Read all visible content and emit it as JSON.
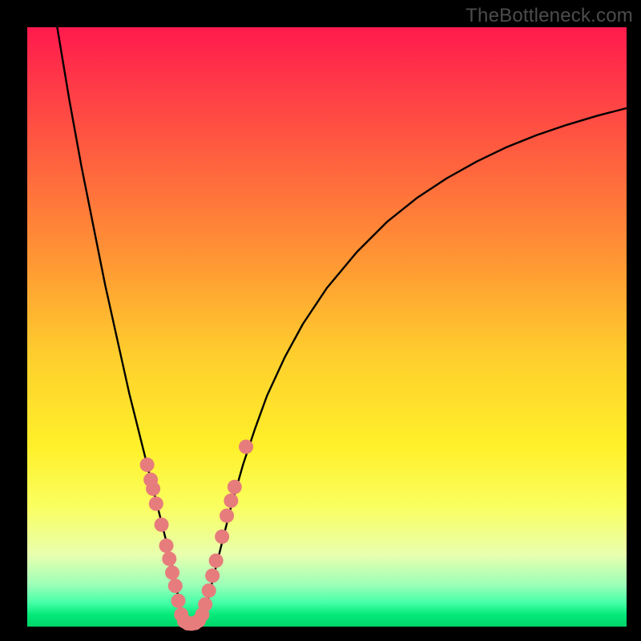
{
  "watermark": "TheBottleneck.com",
  "colors": {
    "frame": "#000000",
    "curve": "#000000",
    "marker": "#e77c7c",
    "gradient_top": "#ff1a4d",
    "gradient_bottom": "#00d46a"
  },
  "chart_data": {
    "type": "line",
    "title": "",
    "xlabel": "",
    "ylabel": "",
    "xlim": [
      0,
      100
    ],
    "ylim": [
      0,
      100
    ],
    "grid": false,
    "legend": false,
    "series": [
      {
        "name": "bottleneck-curve-left",
        "x": [
          5,
          6,
          7,
          8,
          9,
          10,
          11,
          12,
          13,
          14,
          15,
          16,
          17,
          18,
          19,
          20,
          21,
          22,
          23,
          24,
          25,
          25.8
        ],
        "y": [
          100,
          94,
          88,
          82.5,
          77,
          72,
          67,
          62,
          57,
          52.5,
          48,
          43.5,
          39,
          35,
          31,
          27,
          23,
          19,
          15,
          11,
          6,
          1.5
        ]
      },
      {
        "name": "bottleneck-curve-valley",
        "x": [
          25.8,
          26.5,
          27.5,
          28.5,
          29.3
        ],
        "y": [
          1.5,
          0.6,
          0.4,
          0.6,
          1.5
        ]
      },
      {
        "name": "bottleneck-curve-right",
        "x": [
          29.3,
          30,
          31,
          32,
          33,
          34,
          36,
          38,
          40,
          43,
          46,
          50,
          55,
          60,
          65,
          70,
          75,
          80,
          85,
          90,
          95,
          100
        ],
        "y": [
          1.5,
          4,
          8,
          12,
          16,
          20,
          27,
          33,
          38.5,
          45,
          50.5,
          56.5,
          62.5,
          67.5,
          71.5,
          74.8,
          77.6,
          80,
          82,
          83.7,
          85.2,
          86.5
        ]
      }
    ],
    "markers": {
      "name": "highlight-points",
      "points": [
        {
          "x": 20.0,
          "y": 27.0
        },
        {
          "x": 20.6,
          "y": 24.5
        },
        {
          "x": 21.0,
          "y": 23.0
        },
        {
          "x": 21.5,
          "y": 20.5
        },
        {
          "x": 22.4,
          "y": 17.0
        },
        {
          "x": 23.2,
          "y": 13.5
        },
        {
          "x": 23.7,
          "y": 11.3
        },
        {
          "x": 24.2,
          "y": 9.0
        },
        {
          "x": 24.7,
          "y": 6.8
        },
        {
          "x": 25.2,
          "y": 4.3
        },
        {
          "x": 25.7,
          "y": 2.0
        },
        {
          "x": 26.2,
          "y": 0.9
        },
        {
          "x": 26.8,
          "y": 0.55
        },
        {
          "x": 27.4,
          "y": 0.5
        },
        {
          "x": 28.0,
          "y": 0.6
        },
        {
          "x": 28.6,
          "y": 1.0
        },
        {
          "x": 29.2,
          "y": 2.0
        },
        {
          "x": 29.7,
          "y": 3.7
        },
        {
          "x": 30.3,
          "y": 6.0
        },
        {
          "x": 30.9,
          "y": 8.5
        },
        {
          "x": 31.5,
          "y": 11.0
        },
        {
          "x": 32.5,
          "y": 15.0
        },
        {
          "x": 33.3,
          "y": 18.5
        },
        {
          "x": 34.0,
          "y": 21.0
        },
        {
          "x": 34.6,
          "y": 23.3
        },
        {
          "x": 36.5,
          "y": 30.0
        }
      ]
    }
  }
}
